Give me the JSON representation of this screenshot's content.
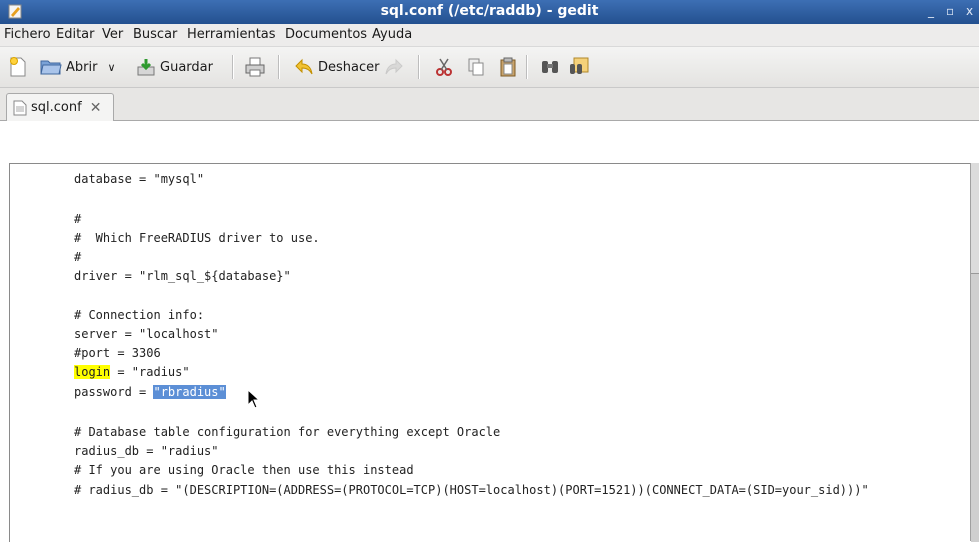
{
  "window": {
    "title": "sql.conf (/etc/raddb) - gedit",
    "controls": [
      "_",
      "▫",
      "x"
    ]
  },
  "menu": {
    "items": [
      {
        "label": "Fichero"
      },
      {
        "label": "Editar"
      },
      {
        "label": "Ver"
      },
      {
        "label": "Buscar"
      },
      {
        "label": "Herramientas"
      },
      {
        "label": "Documentos"
      },
      {
        "label": "Ayuda"
      }
    ]
  },
  "toolbar": {
    "open_label": "Abrir",
    "save_label": "Guardar",
    "undo_label": "Deshacer"
  },
  "tab": {
    "label": "sql.conf",
    "close": "✕"
  },
  "editor": {
    "lines": [
      "database = \"mysql\"",
      "",
      "#",
      "#  Which FreeRADIUS driver to use.",
      "#",
      "driver = \"rlm_sql_${database}\"",
      "",
      "# Connection info:",
      "server = \"localhost\"",
      "#port = 3306",
      "login = \"radius\"",
      "password = \"rbradius\"",
      "",
      "# Database table configuration for everything except Oracle",
      "radius_db = \"radius\"",
      "# If you are using Oracle then use this instead",
      "# radius_db = \"(DESCRIPTION=(ADDRESS=(PROTOCOL=TCP)(HOST=localhost)(PORT=1521))(CONNECT_DATA=(SID=your_sid)))\""
    ],
    "login_key": "login",
    "login_rest": " = \"radius\"",
    "password_key": "password = ",
    "password_value": "\"rbradius\""
  }
}
